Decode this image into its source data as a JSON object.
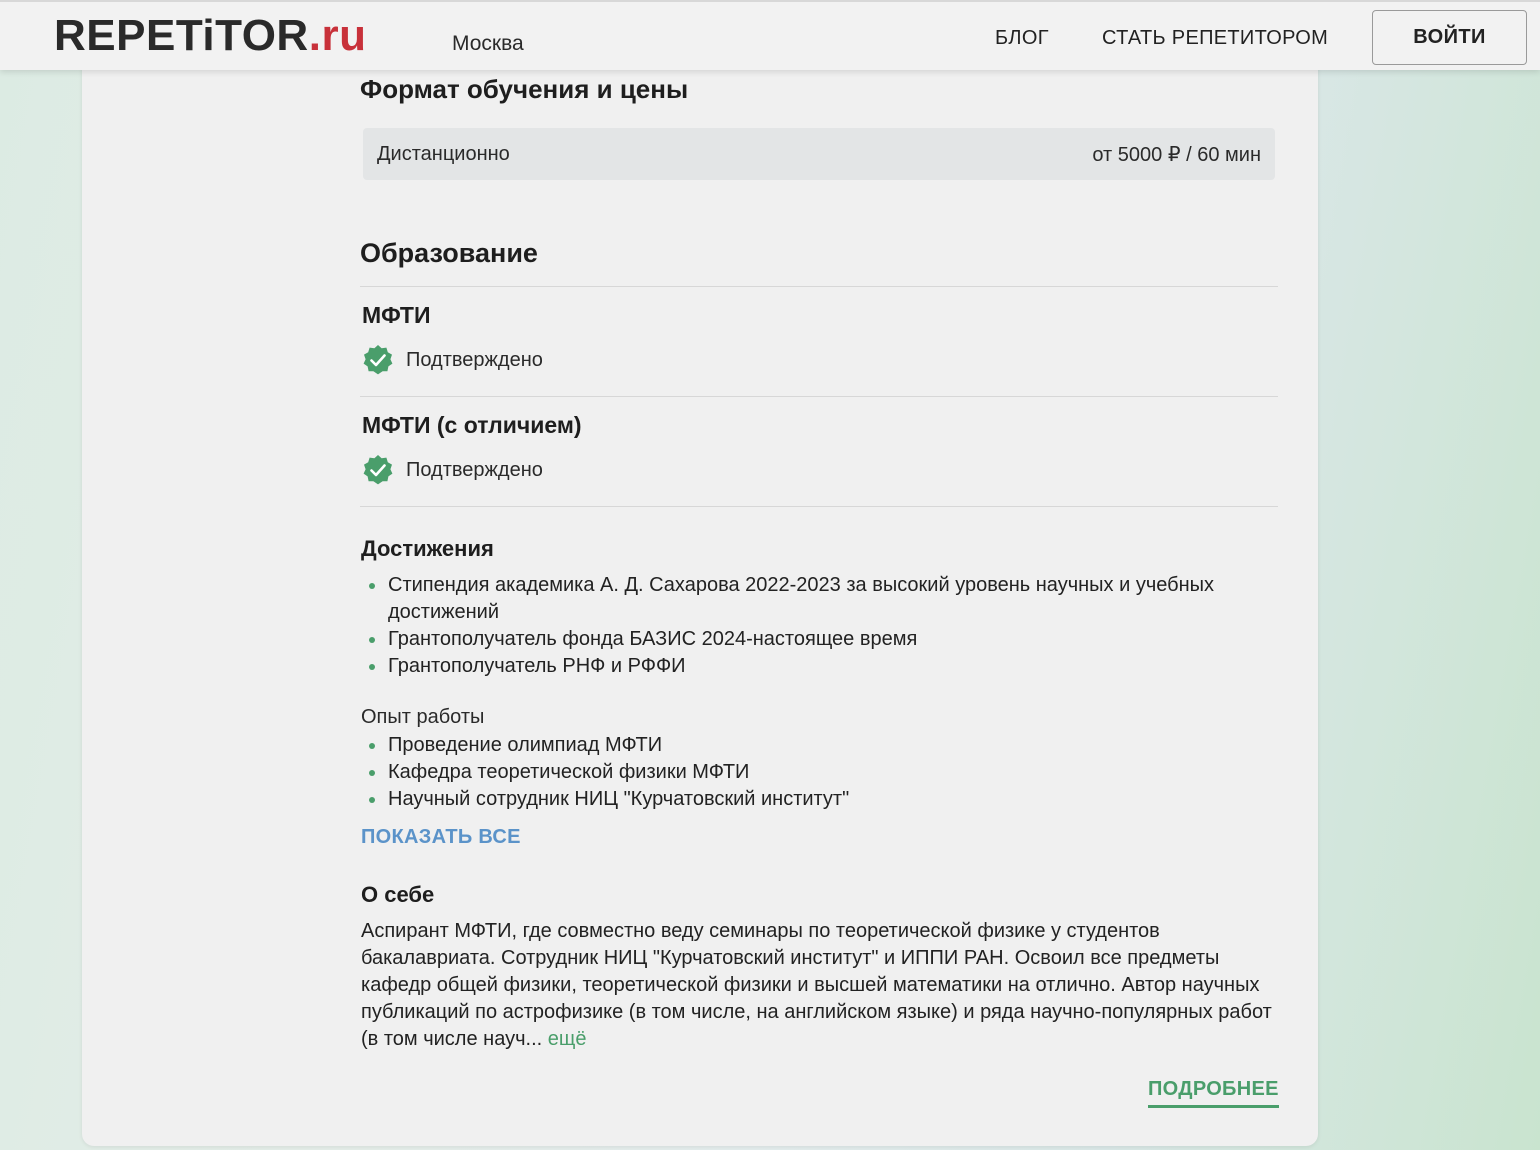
{
  "header": {
    "logo_main": "REPETiTOR",
    "logo_suffix": ".ru",
    "city": "Москва",
    "nav": {
      "blog": "БЛОГ",
      "become_tutor": "СТАТЬ РЕПЕТИТОРОМ"
    },
    "login_label": "ВОЙТИ"
  },
  "format": {
    "title": "Формат обучения и цены",
    "mode": "Дистанционно",
    "price": "от 5000 ₽ / 60 мин"
  },
  "education": {
    "title": "Образование",
    "items": [
      {
        "name": "МФТИ",
        "status": "Подтверждено"
      },
      {
        "name": "МФТИ (с отличием)",
        "status": "Подтверждено"
      }
    ]
  },
  "achievements": {
    "title": "Достижения",
    "items": [
      "Стипендия академика А. Д. Сахарова 2022-2023 за высокий уровень научных и учебных достижений",
      "Грантополучатель фонда БАЗИС 2024-настоящее время",
      "Грантополучатель РНФ и РФФИ"
    ]
  },
  "experience": {
    "label": "Опыт работы",
    "items": [
      "Проведение олимпиад МФТИ",
      "Кафедра теоретической физики МФТИ",
      "Научный сотрудник НИЦ \"Курчатовский институт\""
    ],
    "show_all": "ПОКАЗАТЬ ВСЕ"
  },
  "about": {
    "title": "О себе",
    "text": "Аспирант МФТИ, где совместно веду семинары по теоретической физике у студентов бакалавриата. Сотрудник НИЦ \"Курчатовский институт\" и ИППИ РАН. Освоил все предметы кафедр общей физики, теоретической физики и высшей математики на отлично. Автор научных публикаций по астрофизике (в том числе, на английском языке) и ряда научно-популярных работ (в том числе науч...",
    "more": "ещё"
  },
  "details_label": "ПОДРОБНЕЕ",
  "colors": {
    "accent_green": "#4a9e6b",
    "link_blue": "#5b93c9",
    "logo_red": "#c8313a"
  },
  "icons": {
    "verified": "check-badge-icon"
  }
}
